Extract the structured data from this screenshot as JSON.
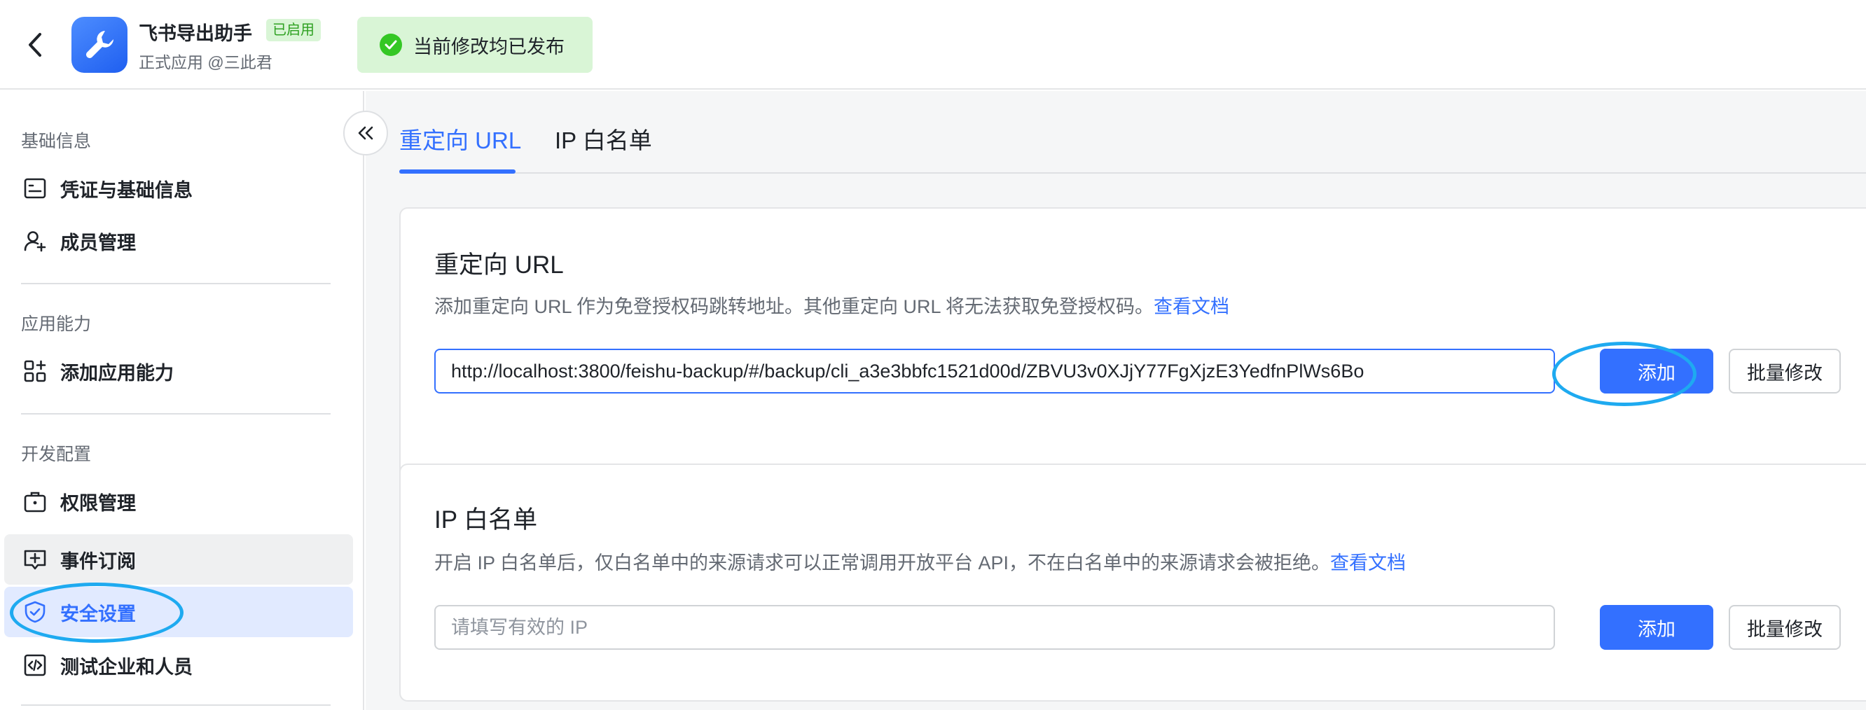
{
  "header": {
    "app_name": "飞书导出助手",
    "app_status_badge": "已启用",
    "app_subtitle": "正式应用 @三此君",
    "publish_status": "当前修改均已发布"
  },
  "sidebar": {
    "groups": [
      {
        "title": "基础信息",
        "items": [
          {
            "label": "凭证与基础信息",
            "icon": "credential-icon"
          },
          {
            "label": "成员管理",
            "icon": "member-add-icon"
          }
        ]
      },
      {
        "title": "应用能力",
        "items": [
          {
            "label": "添加应用能力",
            "icon": "apps-add-icon"
          }
        ]
      },
      {
        "title": "开发配置",
        "items": [
          {
            "label": "权限管理",
            "icon": "briefcase-icon"
          },
          {
            "label": "事件订阅",
            "icon": "event-subscribe-icon"
          },
          {
            "label": "安全设置",
            "icon": "shield-icon",
            "active": true
          },
          {
            "label": "测试企业和人员",
            "icon": "code-icon"
          }
        ]
      }
    ]
  },
  "tabs": [
    {
      "label": "重定向 URL",
      "active": true
    },
    {
      "label": "IP 白名单"
    }
  ],
  "redirect_card": {
    "title": "重定向 URL",
    "description": "添加重定向 URL 作为免登授权码跳转地址。其他重定向 URL 将无法获取免登授权码。",
    "doc_link": "查看文档",
    "input_value": "http://localhost:3800/feishu-backup/#/backup/cli_a3e3bbfc1521d00d/ZBVU3v0XJjY77FgXjzE3YedfnPlWs6Bo",
    "add_button": "添加",
    "batch_button": "批量修改"
  },
  "ip_card": {
    "title": "IP 白名单",
    "description": "开启 IP 白名单后，仅白名单中的来源请求可以正常调用开放平台 API，不在白名单中的来源请求会被拒绝。",
    "doc_link": "查看文档",
    "input_placeholder": "请填写有效的 IP",
    "add_button": "添加",
    "batch_button": "批量修改"
  },
  "colors": {
    "accent": "#3370ff",
    "success": "#34c724",
    "annotation": "#1eaaf0"
  }
}
